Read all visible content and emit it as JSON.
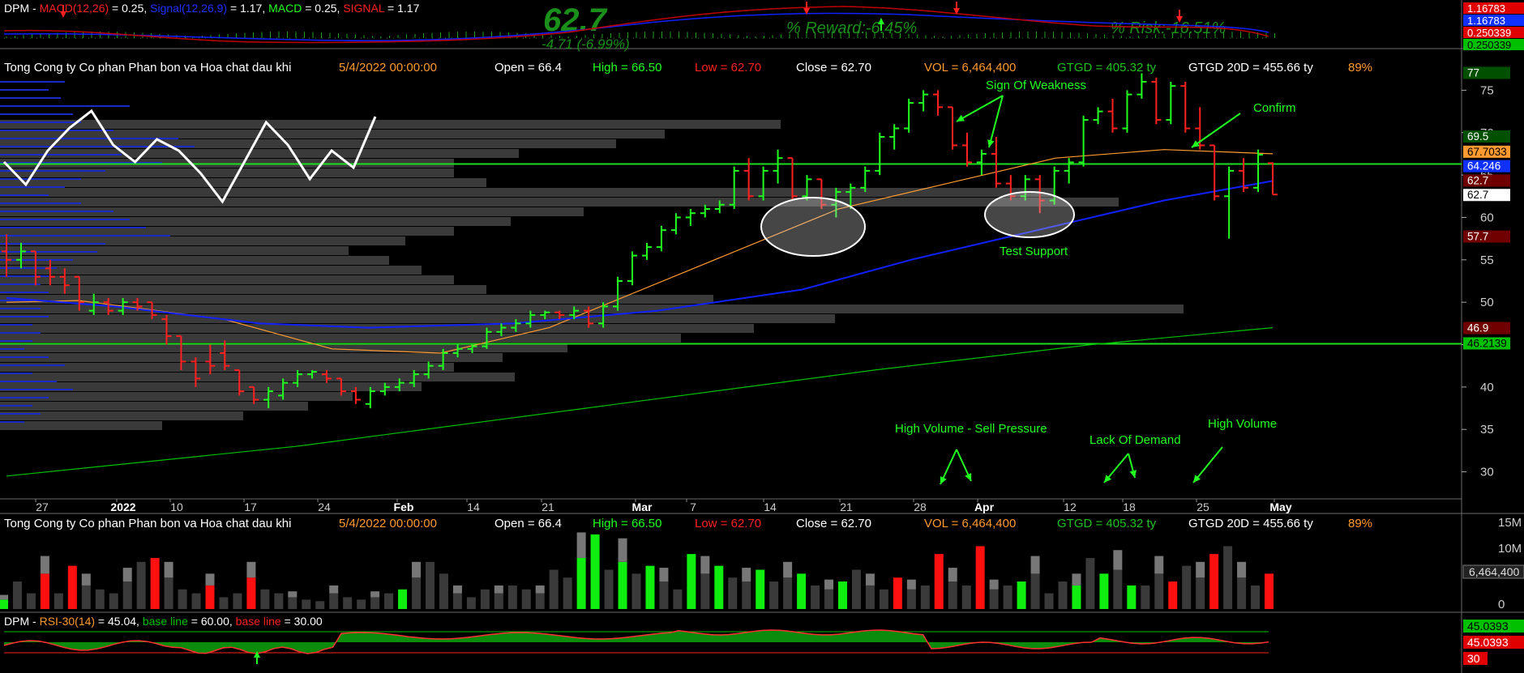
{
  "macd_panel": {
    "items": [
      {
        "text": "DPM",
        "color": "#ffffff"
      },
      {
        "text": " - ",
        "color": "#ffffff"
      },
      {
        "text": "MACD(12,26)",
        "color": "#ff2020"
      },
      {
        "text": " = 0.25, ",
        "color": "#ffffff"
      },
      {
        "text": "Signal(12,26,9)",
        "color": "#2030ff"
      },
      {
        "text": " = 1.17, ",
        "color": "#ffffff"
      },
      {
        "text": "MACD",
        "color": "#20ff20"
      },
      {
        "text": " = 0.25, ",
        "color": "#ffffff"
      },
      {
        "text": "SIGNAL",
        "color": "#ff2020"
      },
      {
        "text": " = 1.17",
        "color": "#ffffff"
      }
    ],
    "big_price": "62.7",
    "change": "-4.71 (-6.99%)",
    "reward": "% Reward:-6.45%",
    "risk": "% Risk:-16.51%",
    "axis_labels": [
      {
        "text": "1.16783",
        "bg": "#e00000",
        "fg": "#ffffff"
      },
      {
        "text": "1.16783",
        "bg": "#1030ff",
        "fg": "#ffffff"
      },
      {
        "text": "0.250339",
        "bg": "#e00000",
        "fg": "#ffffff"
      },
      {
        "text": "0.250339",
        "bg": "#00c000",
        "fg": "#000000"
      }
    ]
  },
  "info_bar": {
    "name": "Tong Cong ty Co phan Phan bon va Hoa chat dau khi",
    "date": "5/4/2022 00:00:00",
    "open": "Open = 66.4",
    "high": "High = 66.50",
    "low": "Low = 62.70",
    "close": "Close = 62.70",
    "vol": "VOL = 6,464,400",
    "gtgd": "GTGD = 405.32  ty",
    "gtgd20": "GTGD 20D = 455.66  ty",
    "pct": "89%"
  },
  "chart_data": [
    {
      "type": "bar",
      "title": "",
      "ohlc_approx": [
        {
          "x": "Dec 22",
          "o": 56,
          "h": 58,
          "l": 53,
          "c": 55
        },
        {
          "x": "Dec 23",
          "o": 55,
          "h": 57,
          "l": 54,
          "c": 56
        },
        {
          "x": "Dec 24",
          "o": 56,
          "h": 56,
          "l": 52,
          "c": 53
        },
        {
          "x": "Dec 27",
          "o": 54,
          "h": 55,
          "l": 52,
          "c": 53
        },
        {
          "x": "Dec 28",
          "o": 53,
          "h": 54,
          "l": 51,
          "c": 52
        },
        {
          "x": "Dec 29",
          "o": 53,
          "h": 53,
          "l": 49,
          "c": 50
        },
        {
          "x": "Dec 30",
          "o": 49,
          "h": 51,
          "l": 48.5,
          "c": 50
        },
        {
          "x": "Dec 31",
          "o": 50,
          "h": 50.5,
          "l": 48.5,
          "c": 49
        },
        {
          "x": "Jan 3",
          "o": 49,
          "h": 50.5,
          "l": 48.5,
          "c": 50
        },
        {
          "x": "Jan 4",
          "o": 50,
          "h": 50.5,
          "l": 49,
          "c": 49.5
        },
        {
          "x": "Jan 5",
          "o": 50,
          "h": 50,
          "l": 48,
          "c": 48.5
        },
        {
          "x": "Jan 6",
          "o": 48,
          "h": 48.5,
          "l": 45,
          "c": 46
        },
        {
          "x": "Jan 7",
          "o": 46,
          "h": 46,
          "l": 42,
          "c": 43
        },
        {
          "x": "Jan 10",
          "o": 43,
          "h": 43.5,
          "l": 40,
          "c": 41
        },
        {
          "x": "Jan 11",
          "o": 43,
          "h": 45,
          "l": 41.5,
          "c": 42.5
        },
        {
          "x": "Jan 12",
          "o": 44,
          "h": 45.5,
          "l": 42,
          "c": 42.5
        },
        {
          "x": "Jan 13",
          "o": 42,
          "h": 42,
          "l": 39,
          "c": 39.5
        },
        {
          "x": "Jan 14",
          "o": 40,
          "h": 40,
          "l": 38,
          "c": 38.5
        },
        {
          "x": "Jan 17",
          "o": 38.5,
          "h": 40,
          "l": 37.5,
          "c": 39.5
        },
        {
          "x": "Jan 18",
          "o": 39,
          "h": 41,
          "l": 38.5,
          "c": 40.5
        },
        {
          "x": "Jan 19",
          "o": 40.5,
          "h": 42,
          "l": 40,
          "c": 41.5
        },
        {
          "x": "Jan 20",
          "o": 41.5,
          "h": 42,
          "l": 41,
          "c": 41.8
        },
        {
          "x": "Jan 21",
          "o": 41.5,
          "h": 42,
          "l": 40.5,
          "c": 41
        },
        {
          "x": "Jan 24",
          "o": 41,
          "h": 41,
          "l": 39,
          "c": 39.5
        },
        {
          "x": "Jan 25",
          "o": 39.5,
          "h": 40,
          "l": 38,
          "c": 38.5
        },
        {
          "x": "Jan 26",
          "o": 38,
          "h": 40,
          "l": 37.5,
          "c": 39.5
        },
        {
          "x": "Jan 27",
          "o": 39.5,
          "h": 40.5,
          "l": 39,
          "c": 40
        },
        {
          "x": "Jan 28",
          "o": 40,
          "h": 41,
          "l": 39.5,
          "c": 40.5
        },
        {
          "x": "Feb 7",
          "o": 40.5,
          "h": 42,
          "l": 40,
          "c": 41.5
        },
        {
          "x": "Feb 8",
          "o": 41.5,
          "h": 43,
          "l": 41,
          "c": 42.5
        },
        {
          "x": "Feb 9",
          "o": 42.5,
          "h": 44.5,
          "l": 42,
          "c": 44
        },
        {
          "x": "Feb 10",
          "o": 44,
          "h": 45,
          "l": 43.5,
          "c": 44.5
        },
        {
          "x": "Feb 11",
          "o": 44.5,
          "h": 45,
          "l": 44,
          "c": 44.8
        },
        {
          "x": "Feb 14",
          "o": 44.8,
          "h": 47,
          "l": 44.5,
          "c": 46.5
        },
        {
          "x": "Feb 15",
          "o": 46.5,
          "h": 47.5,
          "l": 46,
          "c": 47
        },
        {
          "x": "Feb 16",
          "o": 47,
          "h": 48,
          "l": 46.5,
          "c": 47.5
        },
        {
          "x": "Feb 17",
          "o": 47.5,
          "h": 49,
          "l": 47,
          "c": 48.5
        },
        {
          "x": "Feb 18",
          "o": 48.5,
          "h": 49,
          "l": 48,
          "c": 48.8
        },
        {
          "x": "Feb 21",
          "o": 48.8,
          "h": 49,
          "l": 48,
          "c": 48.5
        },
        {
          "x": "Feb 22",
          "o": 48.5,
          "h": 49.5,
          "l": 48,
          "c": 49
        },
        {
          "x": "Feb 23",
          "o": 49,
          "h": 49.5,
          "l": 47,
          "c": 47.5
        },
        {
          "x": "Feb 24",
          "o": 47.5,
          "h": 50,
          "l": 47,
          "c": 49.5
        },
        {
          "x": "Feb 25",
          "o": 49.5,
          "h": 53,
          "l": 49,
          "c": 52.5
        },
        {
          "x": "Feb 28",
          "o": 52.5,
          "h": 56,
          "l": 52,
          "c": 55.5
        },
        {
          "x": "Mar 1",
          "o": 55.5,
          "h": 57,
          "l": 55,
          "c": 56.5
        },
        {
          "x": "Mar 2",
          "o": 56.5,
          "h": 59,
          "l": 56,
          "c": 58.5
        },
        {
          "x": "Mar 3",
          "o": 58.5,
          "h": 60.5,
          "l": 58,
          "c": 60
        },
        {
          "x": "Mar 4",
          "o": 60,
          "h": 61,
          "l": 59,
          "c": 60.5
        },
        {
          "x": "Mar 7",
          "o": 60.5,
          "h": 61.5,
          "l": 60,
          "c": 61
        },
        {
          "x": "Mar 8",
          "o": 61,
          "h": 62,
          "l": 60.5,
          "c": 61.5
        },
        {
          "x": "Mar 9",
          "o": 61.5,
          "h": 66,
          "l": 61,
          "c": 65.5
        },
        {
          "x": "Mar 10",
          "o": 65.5,
          "h": 67,
          "l": 62,
          "c": 62.5
        },
        {
          "x": "Mar 11",
          "o": 62.5,
          "h": 66,
          "l": 62,
          "c": 65.5
        },
        {
          "x": "Mar 14",
          "o": 65.5,
          "h": 68,
          "l": 64,
          "c": 67
        },
        {
          "x": "Mar 15",
          "o": 67,
          "h": 67,
          "l": 62,
          "c": 62.5
        },
        {
          "x": "Mar 16",
          "o": 62.5,
          "h": 65,
          "l": 62,
          "c": 64.5
        },
        {
          "x": "Mar 17",
          "o": 64.5,
          "h": 64.5,
          "l": 61,
          "c": 61.5
        },
        {
          "x": "Mar 18",
          "o": 61.5,
          "h": 63.5,
          "l": 60,
          "c": 63
        },
        {
          "x": "Mar 21",
          "o": 63,
          "h": 64,
          "l": 61,
          "c": 63.5
        },
        {
          "x": "Mar 22",
          "o": 63.5,
          "h": 66,
          "l": 63,
          "c": 65.5
        },
        {
          "x": "Mar 23",
          "o": 65.5,
          "h": 70,
          "l": 65,
          "c": 69.5
        },
        {
          "x": "Mar 24",
          "o": 69.5,
          "h": 71,
          "l": 68,
          "c": 70.5
        },
        {
          "x": "Mar 25",
          "o": 70.5,
          "h": 74,
          "l": 70,
          "c": 73.5
        },
        {
          "x": "Mar 28",
          "o": 73.5,
          "h": 75,
          "l": 72.5,
          "c": 74.5
        },
        {
          "x": "Mar 29",
          "o": 74.5,
          "h": 75,
          "l": 72,
          "c": 73
        },
        {
          "x": "Mar 30",
          "o": 73,
          "h": 73,
          "l": 68,
          "c": 68.5
        },
        {
          "x": "Mar 31",
          "o": 68.5,
          "h": 70,
          "l": 66,
          "c": 66.5
        },
        {
          "x": "Apr 1",
          "o": 66.5,
          "h": 68,
          "l": 65,
          "c": 67.5
        },
        {
          "x": "Apr 4",
          "o": 67.5,
          "h": 69.5,
          "l": 63.5,
          "c": 64
        },
        {
          "x": "Apr 5",
          "o": 64,
          "h": 65,
          "l": 62,
          "c": 62.5
        },
        {
          "x": "Apr 6",
          "o": 62.5,
          "h": 65,
          "l": 62,
          "c": 64.5
        },
        {
          "x": "Apr 7",
          "o": 64.5,
          "h": 65,
          "l": 60.5,
          "c": 62
        },
        {
          "x": "Apr 8",
          "o": 62,
          "h": 66,
          "l": 61.5,
          "c": 65.5
        },
        {
          "x": "Apr 11",
          "o": 65.5,
          "h": 67,
          "l": 64,
          "c": 66.5
        },
        {
          "x": "Apr 12",
          "o": 66.5,
          "h": 72,
          "l": 66,
          "c": 71.5
        },
        {
          "x": "Apr 13",
          "o": 71.5,
          "h": 73,
          "l": 71,
          "c": 72.5
        },
        {
          "x": "Apr 14",
          "o": 72.5,
          "h": 74,
          "l": 70,
          "c": 70.5
        },
        {
          "x": "Apr 15",
          "o": 70.5,
          "h": 75,
          "l": 70,
          "c": 74.5
        },
        {
          "x": "Apr 18",
          "o": 74.5,
          "h": 77,
          "l": 74,
          "c": 76
        },
        {
          "x": "Apr 19",
          "o": 76,
          "h": 76.5,
          "l": 71,
          "c": 71.5
        },
        {
          "x": "Apr 20",
          "o": 71.5,
          "h": 76,
          "l": 71,
          "c": 75.5
        },
        {
          "x": "Apr 21",
          "o": 75.5,
          "h": 76,
          "l": 70,
          "c": 70.5
        },
        {
          "x": "Apr 22",
          "o": 70.5,
          "h": 73,
          "l": 68,
          "c": 68.5
        },
        {
          "x": "Apr 25",
          "o": 68.5,
          "h": 68.5,
          "l": 62,
          "c": 62.5
        },
        {
          "x": "Apr 26",
          "o": 62.5,
          "h": 66,
          "l": 57.5,
          "c": 65.5
        },
        {
          "x": "Apr 27",
          "o": 65.5,
          "h": 67,
          "l": 63,
          "c": 63.5
        },
        {
          "x": "Apr 28",
          "o": 63.5,
          "h": 68,
          "l": 63,
          "c": 67.4
        },
        {
          "x": "May 4",
          "o": 66.4,
          "h": 66.5,
          "l": 62.7,
          "c": 62.7
        }
      ],
      "ylim": [
        27,
        78
      ],
      "yticks": [
        30,
        35,
        40,
        45,
        50,
        55,
        60,
        65,
        70,
        75
      ],
      "x_tick_labels": [
        "27",
        "2022",
        "10",
        "17",
        "24",
        "Feb",
        "14",
        "21",
        "Mar",
        "7",
        "14",
        "21",
        "28",
        "Apr",
        "12",
        "18",
        "25",
        "May"
      ],
      "series": [
        {
          "name": "ma20",
          "color": "#ff9a30",
          "points": [
            [
              0,
              50
            ],
            [
              10,
              50.2
            ],
            [
              30,
              48
            ],
            [
              45,
              44.5
            ],
            [
              60,
              44
            ],
            [
              75,
              47
            ],
            [
              95,
              54
            ],
            [
              115,
              61
            ],
            [
              130,
              64
            ],
            [
              145,
              67
            ],
            [
              160,
              68
            ],
            [
              175,
              67.5
            ]
          ]
        },
        {
          "name": "ma50",
          "color": "#1020ff",
          "points": [
            [
              0,
              50.5
            ],
            [
              15,
              49.5
            ],
            [
              35,
              47.5
            ],
            [
              50,
              47
            ],
            [
              70,
              47.5
            ],
            [
              90,
              49
            ],
            [
              110,
              51.5
            ],
            [
              125,
              55
            ],
            [
              140,
              58
            ],
            [
              160,
              62
            ],
            [
              175,
              64.3
            ]
          ]
        },
        {
          "name": "ma200",
          "color": "#00c000",
          "points": [
            [
              0,
              29.5
            ],
            [
              40,
              33
            ],
            [
              80,
              37.5
            ],
            [
              120,
              42
            ],
            [
              150,
              45
            ],
            [
              175,
              47
            ]
          ]
        }
      ],
      "horizontal_lines": [
        66.3,
        45.1
      ],
      "price_labels": [
        {
          "text": "77",
          "bg": "#005000",
          "fg": "#ffffff",
          "value": 77
        },
        {
          "text": "69.5",
          "bg": "#005000",
          "fg": "#ffffff",
          "value": 69.5
        },
        {
          "text": "67.7033",
          "bg": "#ff9a30",
          "fg": "#000000",
          "value": 67.7
        },
        {
          "text": "64.246",
          "bg": "#1030ff",
          "fg": "#ffffff",
          "value": 66.0
        },
        {
          "text": "62.7",
          "bg": "#700000",
          "fg": "#ffffff",
          "value": 64.3
        },
        {
          "text": "62.7",
          "bg": "#ffffff",
          "fg": "#000000",
          "value": 62.6
        },
        {
          "text": "57.7",
          "bg": "#700000",
          "fg": "#ffffff",
          "value": 57.7
        },
        {
          "text": "46.9",
          "bg": "#700000",
          "fg": "#ffffff",
          "value": 46.9
        },
        {
          "text": "46.2139",
          "bg": "#00c000",
          "fg": "#000000",
          "value": 45.1
        }
      ],
      "rsi_sparkline": [
        0.45,
        0.25,
        0.55,
        0.75,
        0.9,
        0.6,
        0.45,
        0.65,
        0.55,
        0.35,
        0.1,
        0.45,
        0.8,
        0.6,
        0.3,
        0.55,
        0.4,
        0.85
      ],
      "annotations": [
        "Sign Of Weakness",
        "Confirm",
        "Test Support",
        "High Volume - Sell Pressure",
        "Lack Of Demand",
        "High Volume"
      ]
    },
    {
      "type": "bar",
      "title": "Volume",
      "yticks_labels": [
        "15M",
        "10M",
        "5M",
        "0"
      ],
      "last_value_label": "6,464,400"
    },
    {
      "type": "area",
      "title": "RSI",
      "legend": [
        {
          "text": "DPM",
          "color": "#ffffff"
        },
        {
          "text": " - ",
          "color": "#ffffff"
        },
        {
          "text": "RSI-30(14)",
          "color": "#ff9a30"
        },
        {
          "text": " = 45.04, ",
          "color": "#ffffff"
        },
        {
          "text": "base line",
          "color": "#00c000"
        },
        {
          "text": " = 60.00, ",
          "color": "#ffffff"
        },
        {
          "text": "base line",
          "color": "#ff2020"
        },
        {
          "text": " = 30.00",
          "color": "#ffffff"
        }
      ],
      "axis_labels": [
        {
          "text": "45.0393",
          "bg": "#00c000",
          "fg": "#000000"
        },
        {
          "text": "45.0393",
          "bg": "#e00000",
          "fg": "#ffffff"
        },
        {
          "text": "30",
          "bg": "#e00000",
          "fg": "#ffffff"
        }
      ]
    }
  ]
}
